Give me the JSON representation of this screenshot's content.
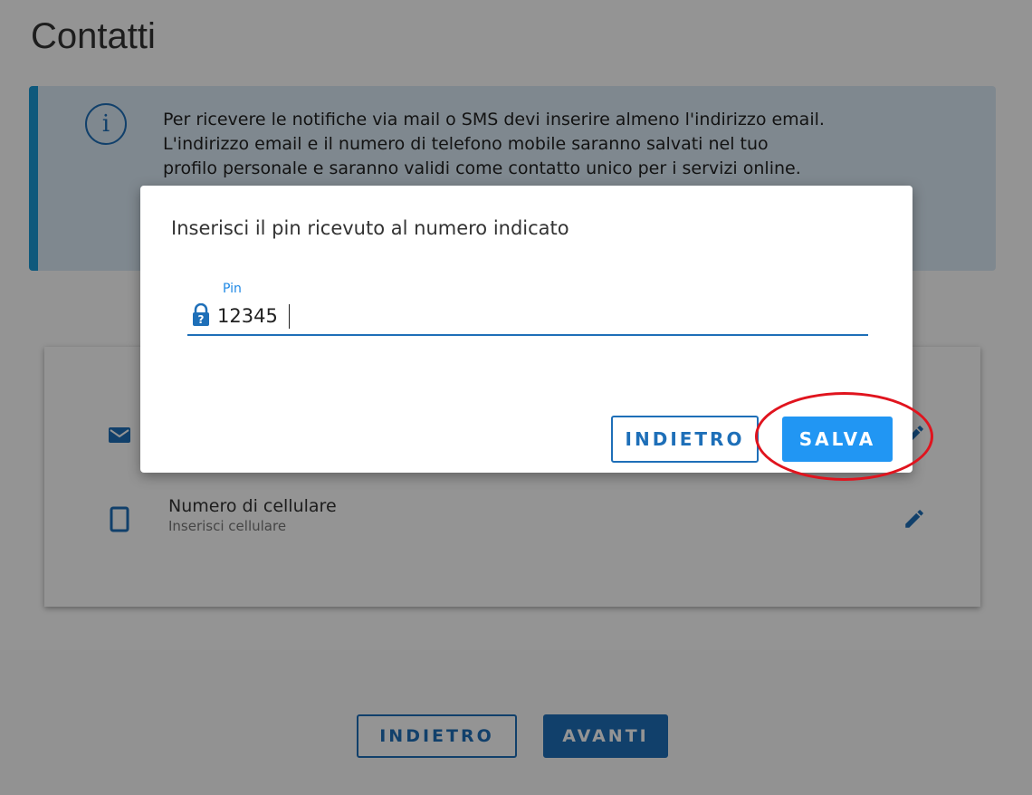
{
  "page": {
    "title": "Contatti"
  },
  "info": {
    "icon": "info-icon",
    "text_line1": "Per ricevere le notifiche via mail o SMS devi inserire almeno l'indirizzo email.",
    "text_line2": "L'indirizzo email e il numero di telefono mobile saranno salvati nel tuo",
    "text_line3": "profilo personale e saranno validi come contatto unico per i servizi online."
  },
  "contacts": {
    "email": {
      "icon": "mail-icon"
    },
    "phone": {
      "icon": "smartphone-icon",
      "label": "Numero di cellulare",
      "placeholder": "Inserisci cellulare"
    }
  },
  "footer": {
    "back_label": "INDIETRO",
    "next_label": "AVANTI"
  },
  "dialog": {
    "title": "Inserisci il pin ricevuto al numero indicato",
    "pin_label": "Pin",
    "pin_value": "12345",
    "back_label": "INDIETRO",
    "save_label": "SALVA"
  },
  "colors": {
    "primary": "#1e6fb8",
    "save_button": "#2196f3",
    "info_accent": "#1b9ad6",
    "highlight": "#e0141e"
  }
}
